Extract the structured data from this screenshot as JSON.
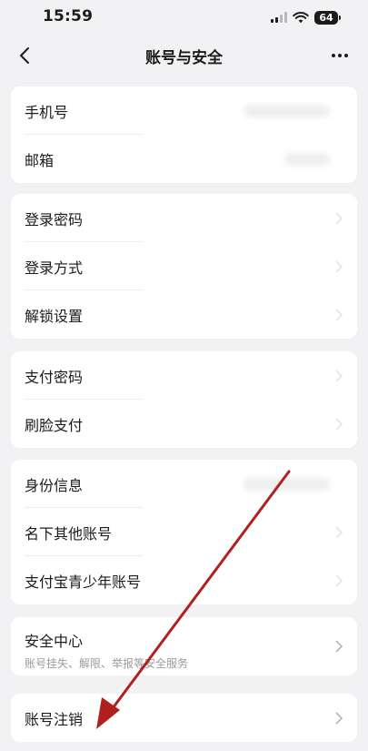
{
  "status_bar": {
    "time": "15:59",
    "battery": "64"
  },
  "nav": {
    "title": "账号与安全"
  },
  "sections": {
    "contact": [
      {
        "label": "手机号"
      },
      {
        "label": "邮箱"
      }
    ],
    "login": [
      {
        "label": "登录密码"
      },
      {
        "label": "登录方式"
      },
      {
        "label": "解锁设置"
      }
    ],
    "payment": [
      {
        "label": "支付密码"
      },
      {
        "label": "刷脸支付"
      }
    ],
    "identity": [
      {
        "label": "身份信息"
      },
      {
        "label": "名下其他账号"
      },
      {
        "label": "支付宝青少年账号"
      }
    ],
    "security_center": {
      "label": "安全中心",
      "subtitle": "账号挂失、解限、举报等安全服务"
    },
    "cancel": {
      "label": "账号注销"
    }
  },
  "icons": {
    "back": "chevron-left-icon",
    "more": "ellipsis-icon",
    "row": "chevron-right-icon"
  },
  "colors": {
    "background": "#f2f2f4",
    "card": "#ffffff",
    "text": "#1b1b1b",
    "subtext": "#9a9a9e",
    "annotation": "#b0201e"
  }
}
